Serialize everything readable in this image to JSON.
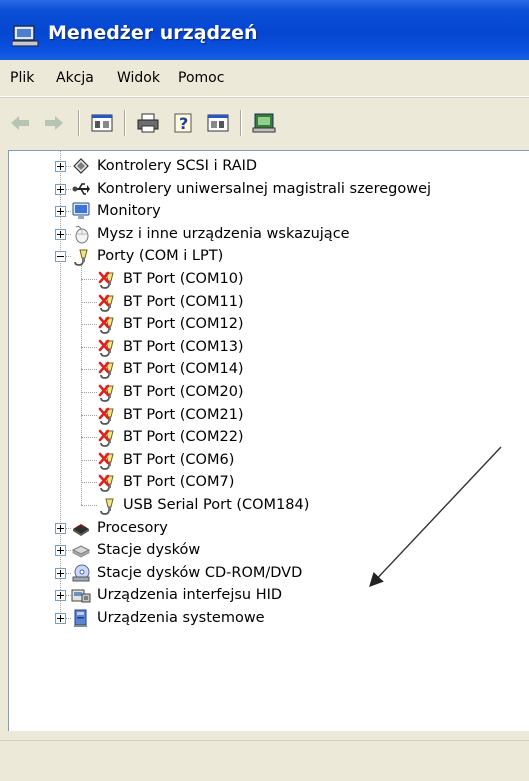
{
  "window": {
    "title": "Menedżer urządzeń"
  },
  "menu": [
    "Plik",
    "Akcja",
    "Widok",
    "Pomoc"
  ],
  "toolbar": [
    "back-icon",
    "forward-icon",
    "properties-view-icon",
    "print-icon",
    "help-icon",
    "console-tree-icon",
    "scan-hardware-icon"
  ],
  "tree": {
    "before": [
      {
        "label": "Kontrolery SCSI i RAID",
        "icon": "scsi-controller-icon"
      },
      {
        "label": "Kontrolery uniwersalnej magistrali szeregowej",
        "icon": "usb-controller-icon"
      },
      {
        "label": "Monitory",
        "icon": "monitor-icon"
      },
      {
        "label": "Mysz i inne urządzenia wskazujące",
        "icon": "mouse-icon"
      }
    ],
    "ports": {
      "label": "Porty (COM i LPT)",
      "children": [
        {
          "label": "BT Port (COM10)",
          "error": true
        },
        {
          "label": "BT Port (COM11)",
          "error": true
        },
        {
          "label": "BT Port (COM12)",
          "error": true
        },
        {
          "label": "BT Port (COM13)",
          "error": true
        },
        {
          "label": "BT Port (COM14)",
          "error": true
        },
        {
          "label": "BT Port (COM20)",
          "error": true
        },
        {
          "label": "BT Port (COM21)",
          "error": true
        },
        {
          "label": "BT Port (COM22)",
          "error": true
        },
        {
          "label": "BT Port (COM6)",
          "error": true
        },
        {
          "label": "BT Port (COM7)",
          "error": true
        },
        {
          "label": "USB Serial Port (COM184)",
          "error": false
        }
      ]
    },
    "after": [
      {
        "label": "Procesory",
        "icon": "processor-icon"
      },
      {
        "label": "Stacje dysków",
        "icon": "floppy-drive-icon"
      },
      {
        "label": "Stacje dysków CD-ROM/DVD",
        "icon": "cdrom-icon"
      },
      {
        "label": "Urządzenia interfejsu HID",
        "icon": "hid-device-icon"
      },
      {
        "label": "Urządzenia systemowe",
        "icon": "system-device-icon"
      }
    ]
  }
}
